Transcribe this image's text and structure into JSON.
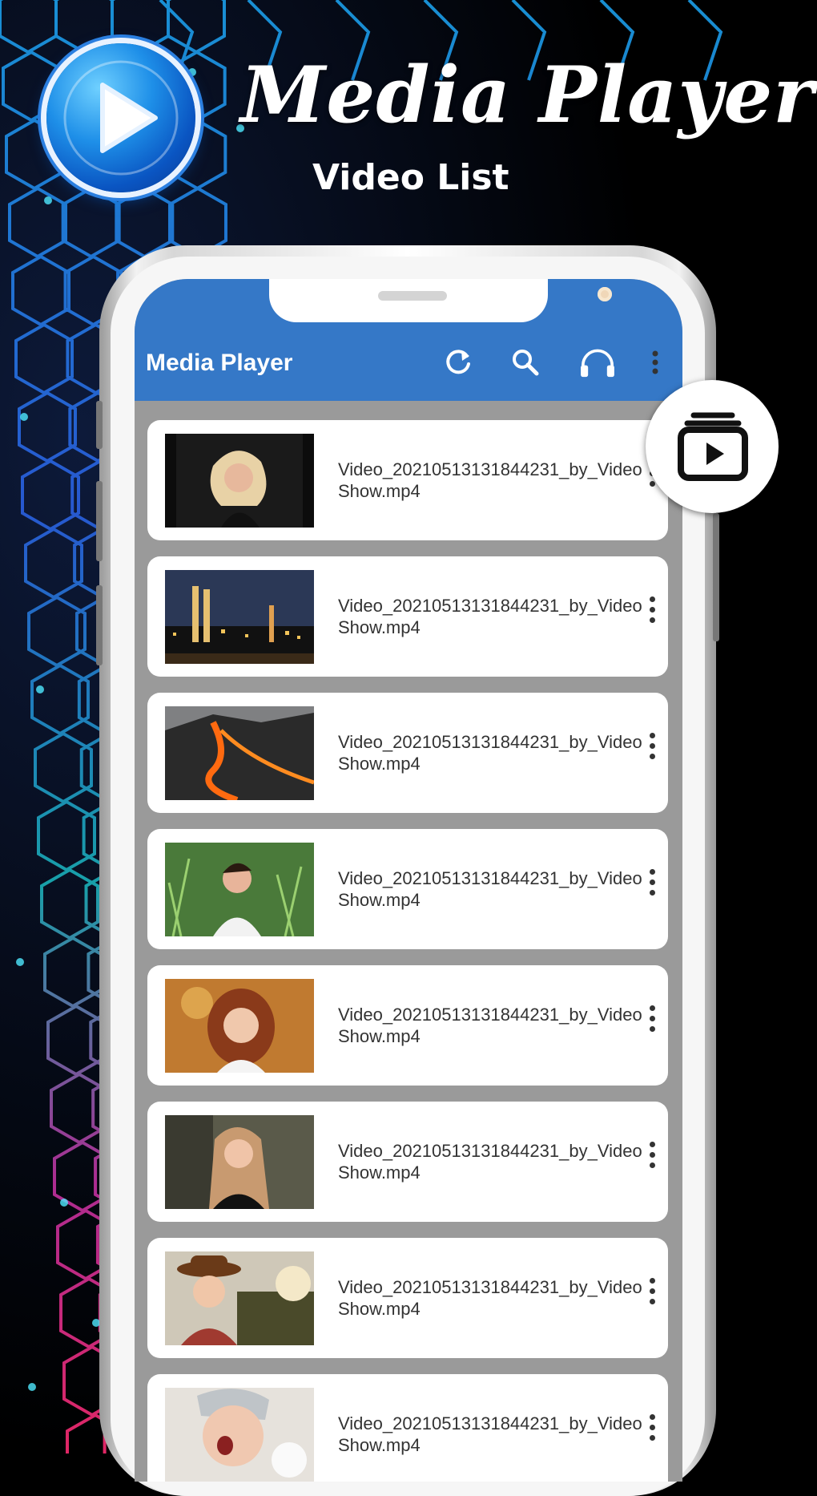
{
  "promo": {
    "title": "Media Player",
    "subtitle": "Video List"
  },
  "app": {
    "title": "Media Player",
    "toolbar_icons": [
      "refresh-icon",
      "search-icon",
      "headphones-icon",
      "more-vertical-icon"
    ]
  },
  "colors": {
    "appbar": "#3578c7",
    "list_background": "#9a9a9a",
    "card": "#ffffff"
  },
  "videos": [
    {
      "name": "Video_20210513131844231_by_VideoShow.mp4",
      "thumb": "woman-portrait-dark"
    },
    {
      "name": "Video_20210513131844231_by_VideoShow.mp4",
      "thumb": "city-skyline-night"
    },
    {
      "name": "Video_20210513131844231_by_VideoShow.mp4",
      "thumb": "lava-flow"
    },
    {
      "name": "Video_20210513131844231_by_VideoShow.mp4",
      "thumb": "woman-in-grass"
    },
    {
      "name": "Video_20210513131844231_by_VideoShow.mp4",
      "thumb": "girl-curly-hair"
    },
    {
      "name": "Video_20210513131844231_by_VideoShow.mp4",
      "thumb": "woman-long-hair"
    },
    {
      "name": "Video_20210513131844231_by_VideoShow.mp4",
      "thumb": "woman-with-hat"
    },
    {
      "name": "Video_20210513131844231_by_VideoShow.mp4",
      "thumb": "baby-yawning"
    }
  ]
}
